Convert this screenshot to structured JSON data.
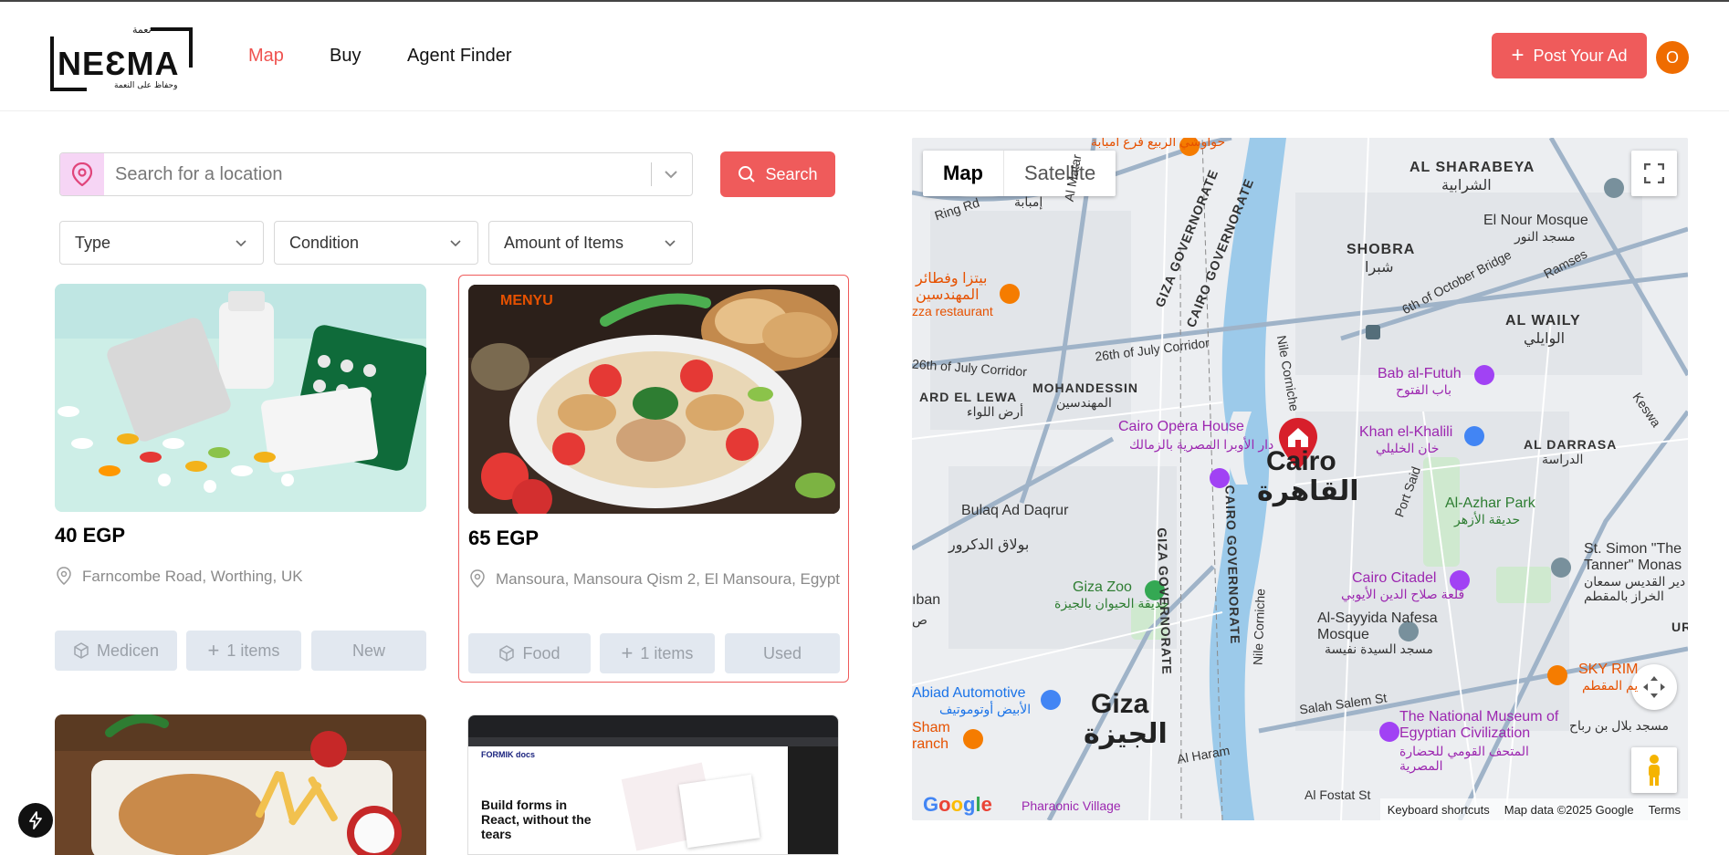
{
  "header": {
    "logo_text": "NEƐMA",
    "logo_arabic_top": "نعمة",
    "logo_arabic_sub": "وحفاظ على النعمة",
    "nav": [
      "Map",
      "Buy",
      "Agent Finder"
    ],
    "post_button": "Post Your Ad",
    "avatar": "O"
  },
  "search": {
    "placeholder": "Search for a location",
    "button": "Search"
  },
  "filters": [
    "Type",
    "Condition",
    "Amount of Items"
  ],
  "cards": [
    {
      "price": "40 EGP",
      "location": "Farncombe Road, Worthing, UK",
      "category": "Medicen",
      "items": "1 items",
      "condition": "New"
    },
    {
      "price": "65 EGP",
      "location": "Mansoura, Mansoura Qism 2, El Mansoura, Egypt",
      "category": "Food",
      "items": "1 items",
      "condition": "Used"
    }
  ],
  "screenshot_card": {
    "logo": "FORMIK docs",
    "headline": "Build forms in React, without the tears"
  },
  "map": {
    "tabs": [
      "Map",
      "Satellite"
    ],
    "labels": {
      "al_sharabeya": "AL SHARABEYA",
      "al_sharabeya_ar": "الشرابية",
      "shobra": "SHOBRA",
      "shobra_ar": "شبرا",
      "al_waily": "AL WAILY",
      "al_waily_ar": "الوايلي",
      "mohandessin": "MOHANDESSIN",
      "mohandessin_ar": "المهندسين",
      "ard_el_lewa": "ARD EL LEWA",
      "ard_el_lewa_ar": "أرض اللواء",
      "cairo": "Cairo",
      "cairo_ar": "القاهرة",
      "giza": "Giza",
      "giza_ar": "الجيزة",
      "bulaq": "Bulaq Ad Daqrur",
      "bulaq_ar": "بولاق الدكرور",
      "opera": "Cairo Opera House",
      "opera_ar": "دار الأوبرا المصرية بالزمالك",
      "khan": "Khan el-Khalili",
      "khan_ar": "خان الخليلي",
      "bab": "Bab al-Futuh",
      "bab_ar": "باب الفتوح",
      "azhar": "Al-Azhar Park",
      "azhar_ar": "حديقة الأزهر",
      "citadel": "Cairo Citadel",
      "citadel_ar": "قلعة صلاح الدين الأيوبي",
      "sayyida": "Al-Sayyida Nafesa Mosque",
      "sayyida_ar": "مسجد السيدة نفيسة",
      "zoo": "Giza Zoo",
      "zoo_ar": "حديقة الحيوان بالجيزة",
      "museum": "The National Museum of Egyptian Civilization",
      "museum_ar": "المتحف القومي للحضارة المصرية",
      "nour": "El Nour Mosque",
      "nour_ar": "مسجد النور",
      "simon": "St. Simon \"The Tanner\" Monas",
      "simon_ar": "دير القديس سمعان الخراز بالمقطم",
      "darrasa": "AL DARRASA",
      "darrasa_ar": "الدراسة",
      "pizza": "بيتزا وفطائر المهندسين",
      "pizza_en": "zza restaurant",
      "abiad": "Abiad Automotive",
      "abiad_ar": "الأبيض أوتوموتيف",
      "sky": "SKY RIM",
      "sky_ar": "يم المقطم",
      "sham": "Sham",
      "sham_sub": "ranch",
      "giza_gov_1": "GIZA GOVERNORATE",
      "cairo_gov_1": "CAIRO GOVERNORATE",
      "imbaba": "إمبابة",
      "ring": "Ring Rd",
      "matar": "Al Matar",
      "october": "26th of July Corridor",
      "sixth_oct": "6th of October Bridge",
      "salah_salem": "Salah Salem St",
      "nile_corniche": "Nile Corniche",
      "haram": "Al Haram",
      "port_said": "Port Said",
      "pharaonic": "Pharaonic Village",
      "hawawshy": "حواوشي الربيع فرع أمبابة",
      "ramses": "Ramses",
      "keswa": "Keswa",
      "ur": "UR",
      "aban": "ıban",
      "sad": "ص",
      "fostat": "Al Fostat St",
      "mosque_bilal": "مسجد بلال بن رباح"
    },
    "footer": [
      "Keyboard shortcuts",
      "Map data ©2025 Google",
      "Terms"
    ],
    "google": "Google"
  },
  "colors": {
    "accent": "#ef5b5b",
    "avatar": "#ef6c00",
    "pin_bg": "#f6d5f5"
  }
}
